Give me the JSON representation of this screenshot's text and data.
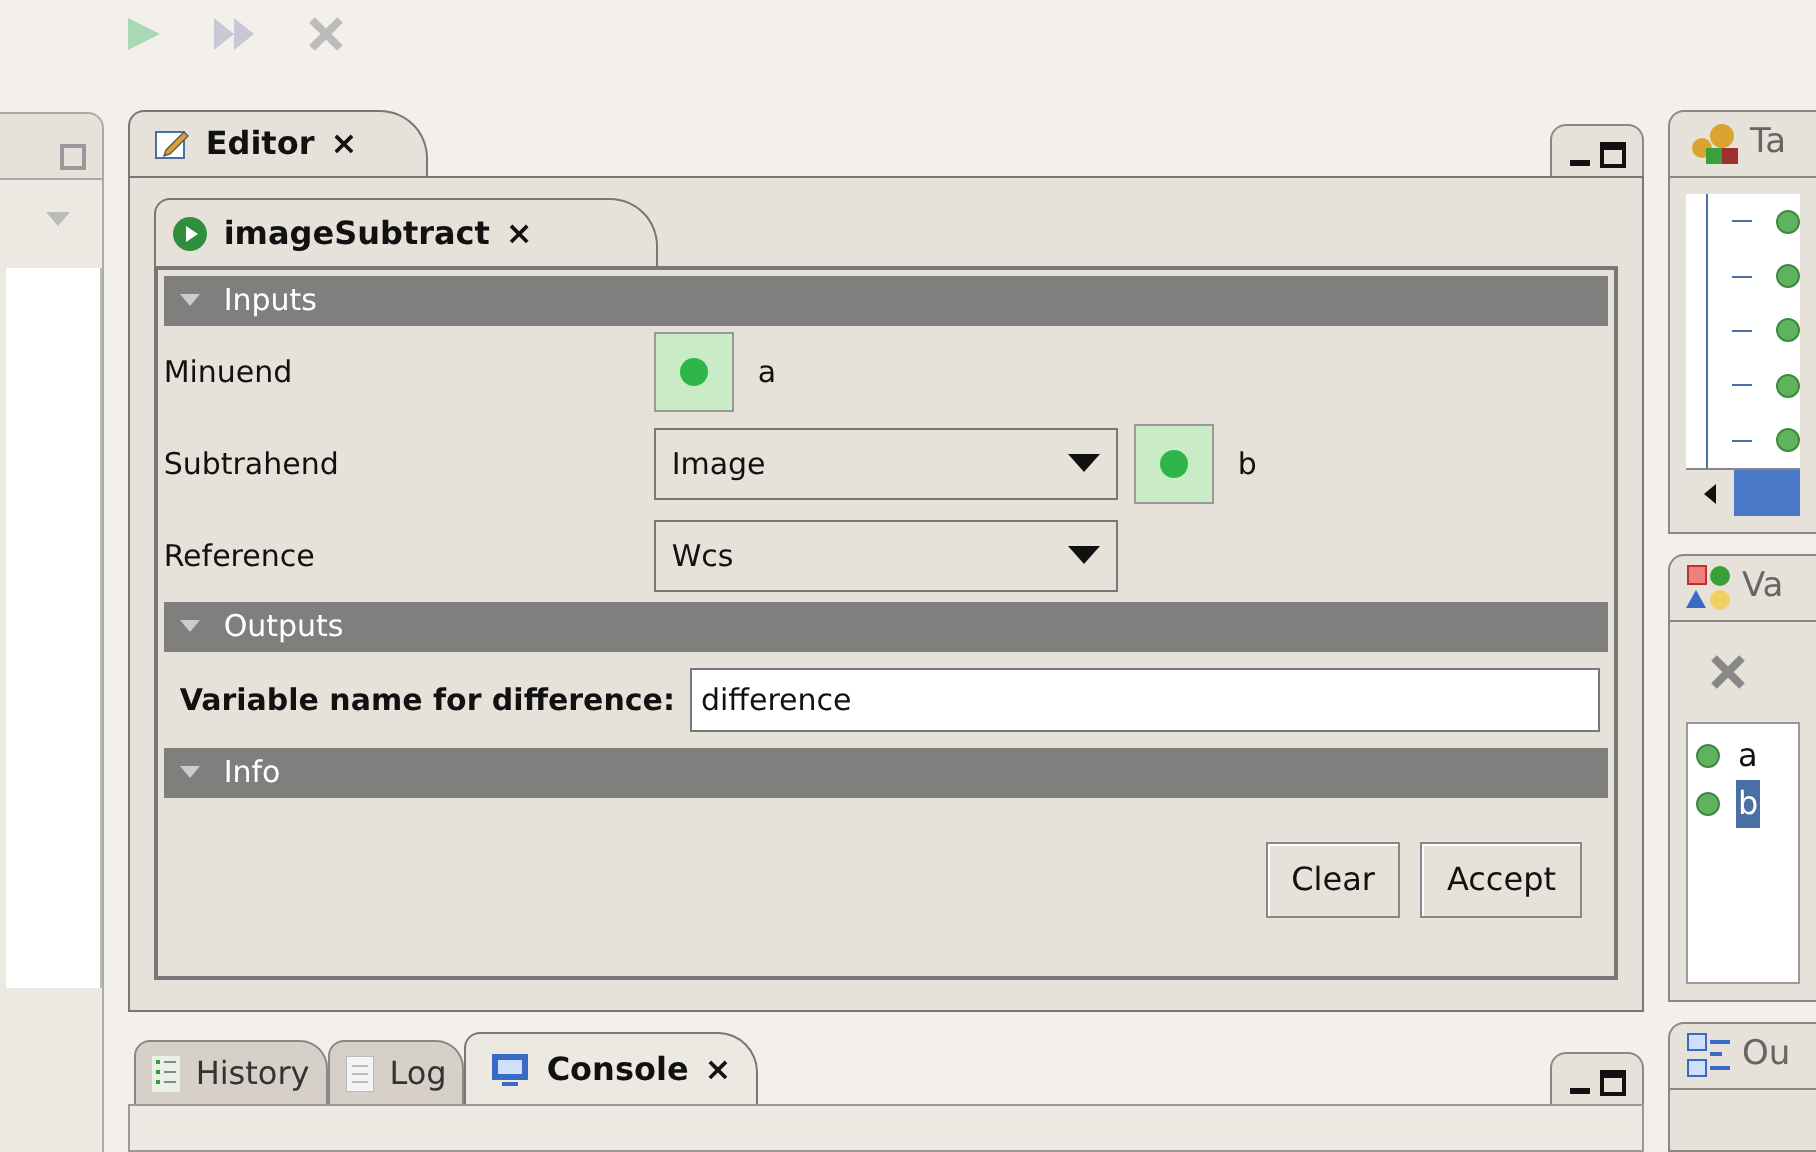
{
  "editor": {
    "tab": {
      "label": "Editor",
      "close": "×"
    },
    "document_tab": {
      "label": "imageSubtract",
      "close": "×"
    },
    "sections": [
      {
        "title": "Inputs",
        "expanded": true,
        "rows": [
          {
            "kind": "variable",
            "label": "Minuend",
            "variable": "a"
          },
          {
            "kind": "choice_variable",
            "label": "Subtrahend",
            "choice": "Image",
            "variable": "b"
          },
          {
            "kind": "choice",
            "label": "Reference",
            "choice": "Wcs"
          }
        ]
      },
      {
        "title": "Outputs",
        "expanded": true,
        "rows": [
          {
            "kind": "text",
            "label": "Variable name for difference:",
            "value": "difference"
          }
        ]
      },
      {
        "title": "Info",
        "expanded": true
      }
    ],
    "buttons": [
      "Clear",
      "Accept"
    ]
  },
  "bottom_tabs": [
    {
      "label": "History",
      "selected": false
    },
    {
      "label": "Log",
      "selected": false
    },
    {
      "label": "Console",
      "selected": true,
      "close": "×"
    }
  ],
  "right_panels": [
    {
      "title": "Ta"
    },
    {
      "title": "Va",
      "items": [
        {
          "label": "a",
          "selected": false
        },
        {
          "label": "b",
          "selected": true
        }
      ]
    },
    {
      "title": "Ou"
    }
  ]
}
